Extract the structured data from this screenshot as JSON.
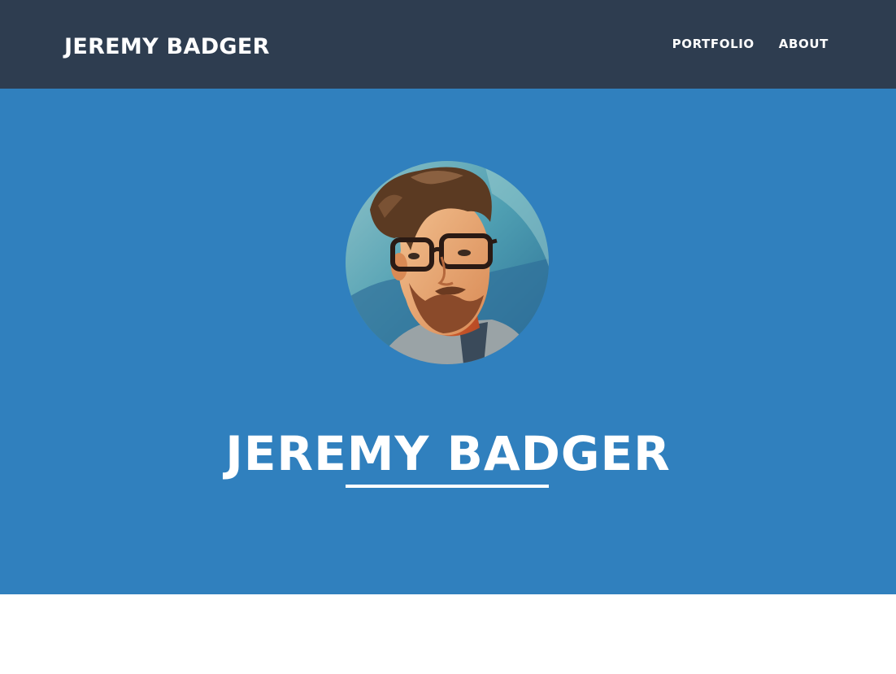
{
  "navbar": {
    "brand": "JEREMY BADGER",
    "links": [
      "PORTFOLIO",
      "ABOUT"
    ]
  },
  "hero": {
    "title": "JEREMY BADGER",
    "avatar": "profile-portrait-illustration"
  },
  "colors": {
    "navbar_bg": "#2e3d50",
    "hero_bg": "#3080be",
    "text": "#ffffff"
  }
}
